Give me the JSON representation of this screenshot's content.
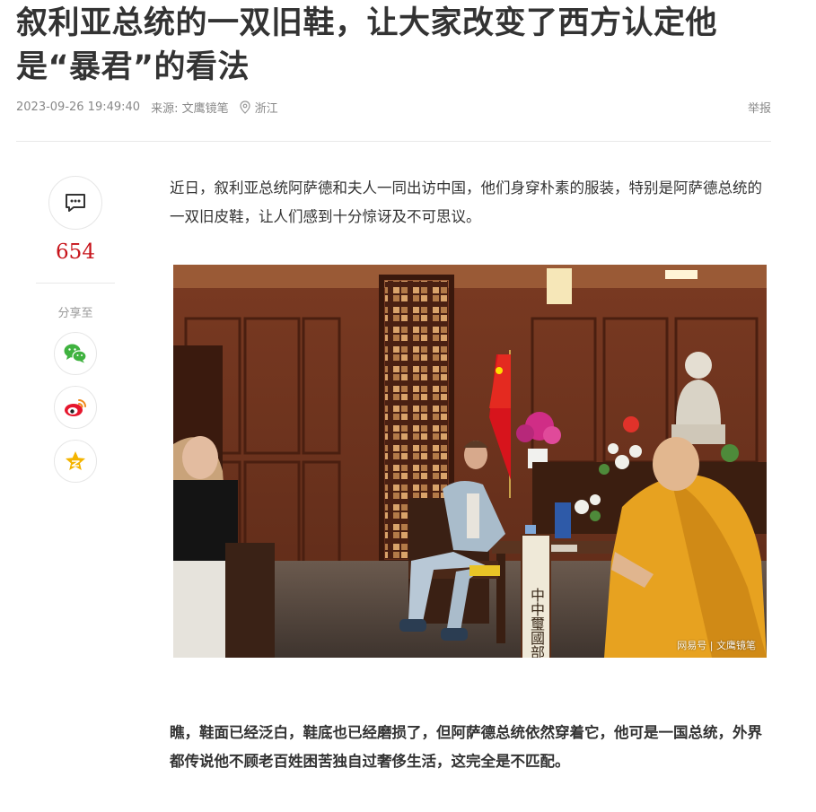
{
  "article": {
    "title": "叙利亚总统的一双旧鞋，让大家改变了西方认定他是“暴君”的看法",
    "datetime": "2023-09-26 19:49:40",
    "source": "来源: 文鹰镜笔",
    "location": "浙江",
    "report_label": "举报",
    "paragraph_1": "近日，叙利亚总统阿萨德和夫人一同出访中国，他们身穿朴素的服装，特别是阿萨德总统的一双旧皮鞋，让人们感到十分惊讶及不可思议。",
    "paragraph_2": "瞧，鞋面已经泛白，鞋底也已经磨损了，但阿萨德总统依然穿着它，他可是一国总统，外界都传说他不顾老百姓困苦独自过奢侈生活，这完全是不匹配。"
  },
  "sidebar": {
    "comment_count": "654",
    "share_label": "分享至",
    "icons": [
      "comment-icon",
      "wechat-icon",
      "weibo-icon",
      "favorite-star-icon"
    ]
  },
  "photo": {
    "watermark": "网易号 | 文鹰镜笔",
    "scroll_text": "中中璽國部霹靈"
  },
  "colors": {
    "title": "#333333",
    "meta": "#888888",
    "count": "#c7131a",
    "wechat": "#3fb23f",
    "weibo": "#e6162d",
    "star": "#f4b400"
  }
}
